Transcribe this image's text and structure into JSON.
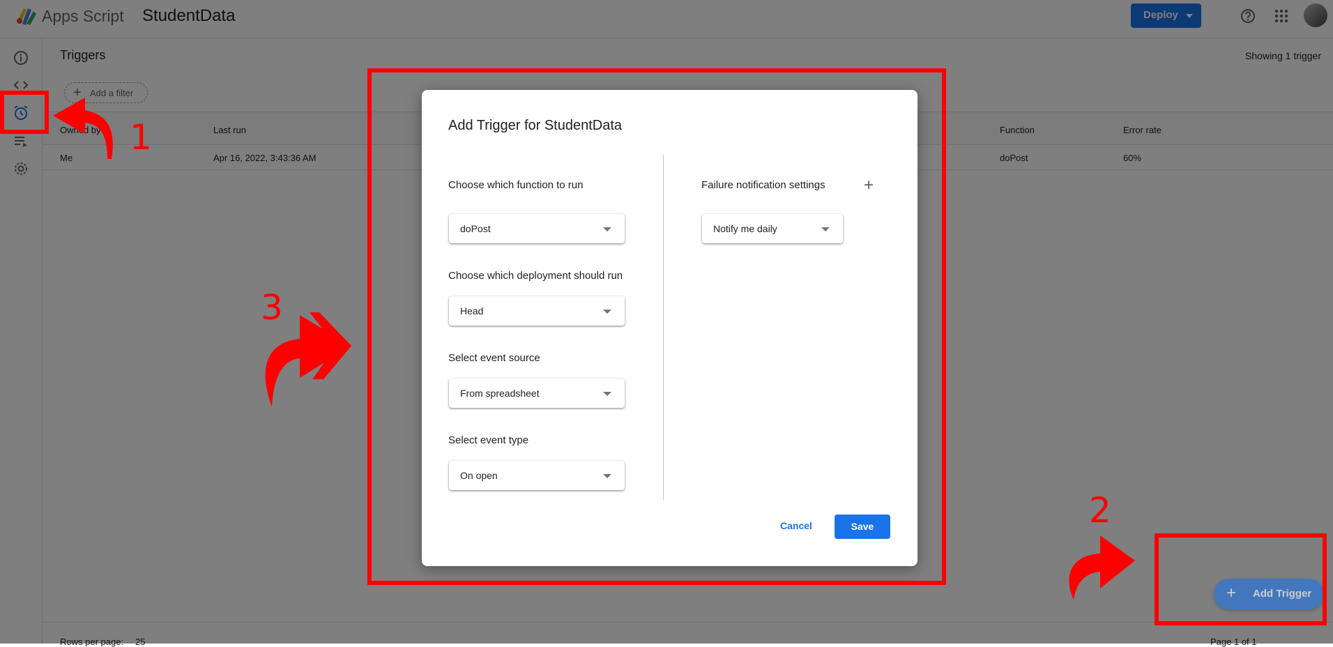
{
  "header": {
    "app_name": "Apps Script",
    "project_name": "StudentData",
    "deploy_label": "Deploy",
    "help_icon": "help-circle-icon",
    "apps_icon": "apps-grid-icon",
    "account_icon": "avatar"
  },
  "rail": {
    "items": [
      {
        "icon": "info-icon",
        "active": false
      },
      {
        "icon": "code-icon",
        "active": false
      },
      {
        "icon": "alarm-clock-icon",
        "active": true
      },
      {
        "icon": "playlist-icon",
        "active": false
      },
      {
        "icon": "gear-icon",
        "active": false
      }
    ]
  },
  "page": {
    "title": "Triggers",
    "showing": "Showing 1 trigger",
    "filter_label": "Add a filter"
  },
  "table": {
    "headers": [
      "Owned by",
      "Last run",
      "Function",
      "Error rate"
    ],
    "rows": [
      {
        "owner": "Me",
        "last_run": "Apr 16, 2022, 3:43:36 AM",
        "function": "doPost",
        "error_rate": "60%"
      }
    ]
  },
  "footer": {
    "rows_per_page_label": "Rows per page:",
    "rows_per_page": "25",
    "pagination": "Page 1 of 1"
  },
  "fab": {
    "label": "Add Trigger"
  },
  "dialog": {
    "title": "Add Trigger for StudentData",
    "function_label": "Choose which function to run",
    "function_value": "doPost",
    "deployment_label": "Choose which deployment should run",
    "deployment_value": "Head",
    "event_source_label": "Select event source",
    "event_source_value": "From spreadsheet",
    "event_type_label": "Select event type",
    "event_type_value": "On open",
    "failure_label": "Failure notification settings",
    "failure_value": "Notify me daily",
    "cancel_label": "Cancel",
    "save_label": "Save"
  },
  "annotations": {
    "step1": "1",
    "step2": "2",
    "step3": "3",
    "color": "#ff0000"
  },
  "colors": {
    "primary": "#1a73e8",
    "scrim": "rgba(0,0,0,0.5)"
  }
}
